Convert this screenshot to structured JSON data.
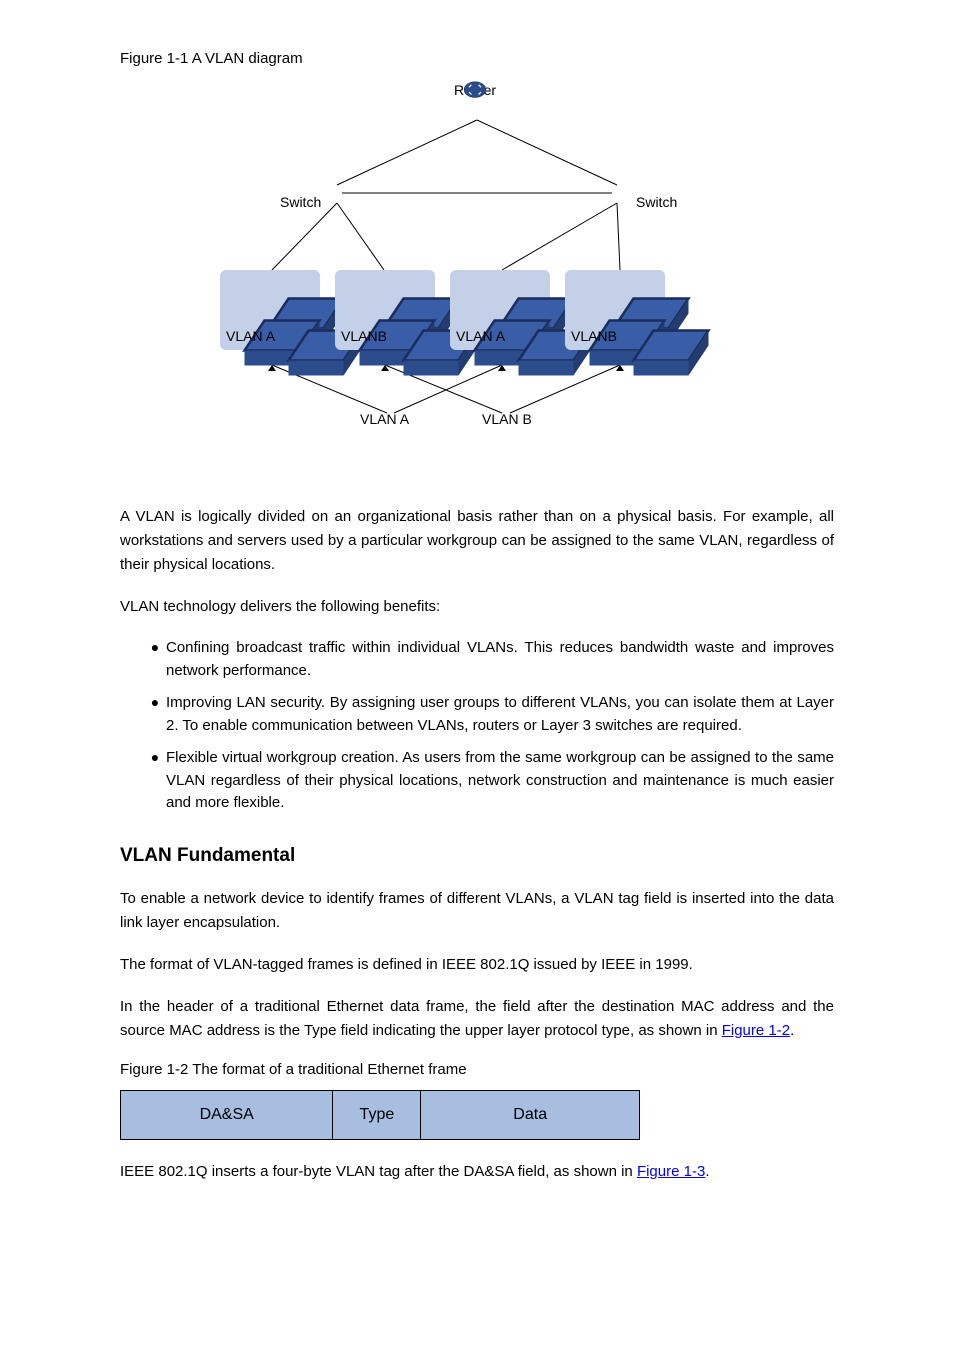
{
  "figure1_label": "Figure 1-1 A VLAN diagram",
  "diagram": {
    "router": "Router",
    "switch_left": "Switch",
    "switch_right": "Switch",
    "vlan_a": "VLAN A",
    "vlan_b": "VLANB",
    "bottom_vlan_a": "VLAN A",
    "bottom_vlan_b": "VLAN B"
  },
  "para1": "A VLAN is logically divided on an organizational basis rather than on a physical basis. For example, all workstations and servers used by a particular workgroup can be assigned to the same VLAN, regardless of their physical locations.",
  "intro_list": "VLAN technology delivers the following benefits:",
  "bullets": [
    "Confining broadcast traffic within individual VLANs. This reduces bandwidth waste and improves network performance.",
    "Improving LAN security. By assigning user groups to different VLANs, you can isolate them at Layer 2. To enable communication between VLANs, routers or Layer 3 switches are required.",
    "Flexible virtual workgroup creation. As users from the same workgroup can be assigned to the same VLAN regardless of their physical locations, network construction and maintenance is much easier and more flexible."
  ],
  "section": "VLAN Fundamental",
  "para2": "To enable a network device to identify frames of different VLANs, a VLAN tag field is inserted into the data link layer encapsulation.",
  "para3_a": "The format of VLAN-tagged frames is defined in IEEE 802.1Q issued by IEEE in 1999.",
  "para3_b": "In the header of a traditional Ethernet data frame, the field after the destination MAC address and the source MAC address is the Type field indicating the upper layer protocol type, as shown in ",
  "para3_link": "Figure 1-2",
  "para3_c": ".",
  "figure2_label": "Figure 1-2 The format of a traditional Ethernet frame",
  "frame_cells": {
    "dasa": "DA&SA",
    "type": "Type",
    "data": "Data"
  },
  "para4_a": "IEEE 802.1Q inserts a four-byte VLAN tag after the DA&SA field, as shown in ",
  "para4_link": "Figure 1-3",
  "para4_b": "."
}
